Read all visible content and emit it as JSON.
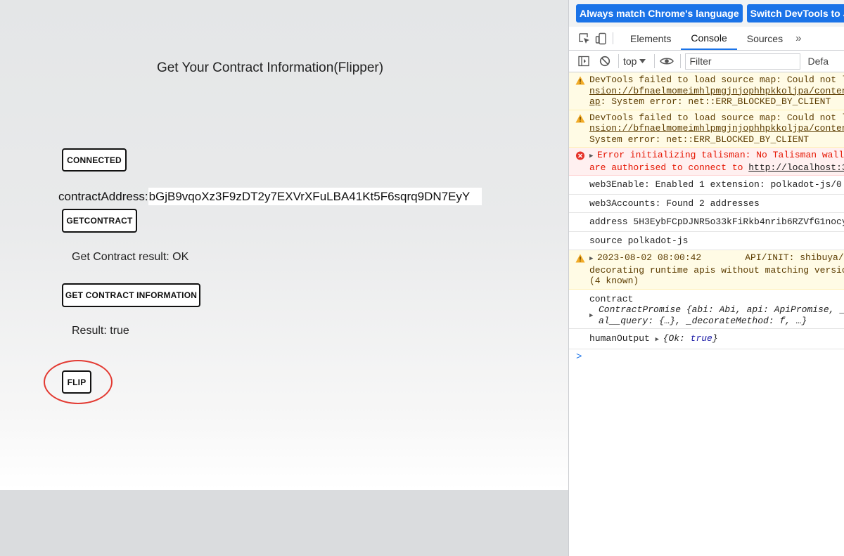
{
  "app": {
    "title": "Get Your Contract Information(Flipper)",
    "connected_label": "CONNECTED",
    "contract_address_label": "contractAddress:",
    "contract_address_value": "bGjB9vqoXz3F9zDT2y7EXVrXFuLBA41Kt5F6sqrq9DN7EyY",
    "get_contract_label": "GETCONTRACT",
    "get_contract_result": "Get Contract result: OK",
    "get_info_label": "GET CONTRACT INFORMATION",
    "info_result": "Result: true",
    "flip_label": "FLIP",
    "highlight_color": "#e33a32"
  },
  "devtools": {
    "infobar": {
      "match_language_label": "Always match Chrome's language",
      "switch_language_label": "Switch DevTools to Ja"
    },
    "tabs": [
      {
        "label": "Elements",
        "active": false
      },
      {
        "label": "Console",
        "active": true
      },
      {
        "label": "Sources",
        "active": false
      }
    ],
    "more_tabs": "»",
    "toolbar": {
      "context": "top",
      "filter_placeholder": "Filter",
      "levels": "Defa"
    },
    "console": {
      "warn1": {
        "l1": "DevTools failed to load source map: Could not l",
        "l2": "nsion://bfnaelmomeimhlpmgjnjophhpkkoljpa/conten",
        "l3_link": "ap",
        "l3_rest": ": System error: net::ERR_BLOCKED_BY_CLIENT"
      },
      "warn2": {
        "l1": "DevTools failed to load source map: Could not l",
        "l2": "nsion://bfnaelmomeimhlpmgjnjophhpkkoljpa/conten",
        "l3": "System error: net::ERR_BLOCKED_BY_CLIENT"
      },
      "error1": {
        "l1": "Error initializing talisman: No Talisman wall",
        "l2_text": "are authorised to connect to ",
        "l2_link": "http://localhost:3"
      },
      "log_enable": "web3Enable: Enabled 1 extension: polkadot-js/0.",
      "log_accounts": "web3Accounts: Found 2 addresses",
      "log_address": "address 5H3EybFCpDJNR5o33kFiRkb4nrib6RZVfG1nocy",
      "log_source": "source polkadot-js",
      "warn3": {
        "l1_time": "2023-08-02 08:00:42",
        "l1_rest": "API/INIT: shibuya/",
        "l2": "decorating runtime apis without matching versio",
        "l3": "(4 known)"
      },
      "log_contract": {
        "l1": "contract",
        "l2": "ContractPromise {abi: Abi, api: ApiPromise, _",
        "l3": "al__query: {…}, _decorateMethod: f, …}"
      },
      "log_human": {
        "label": "humanOutput ",
        "obj_open": "{Ok: ",
        "obj_value": "true",
        "obj_close": "}"
      },
      "prompt": ">"
    }
  }
}
